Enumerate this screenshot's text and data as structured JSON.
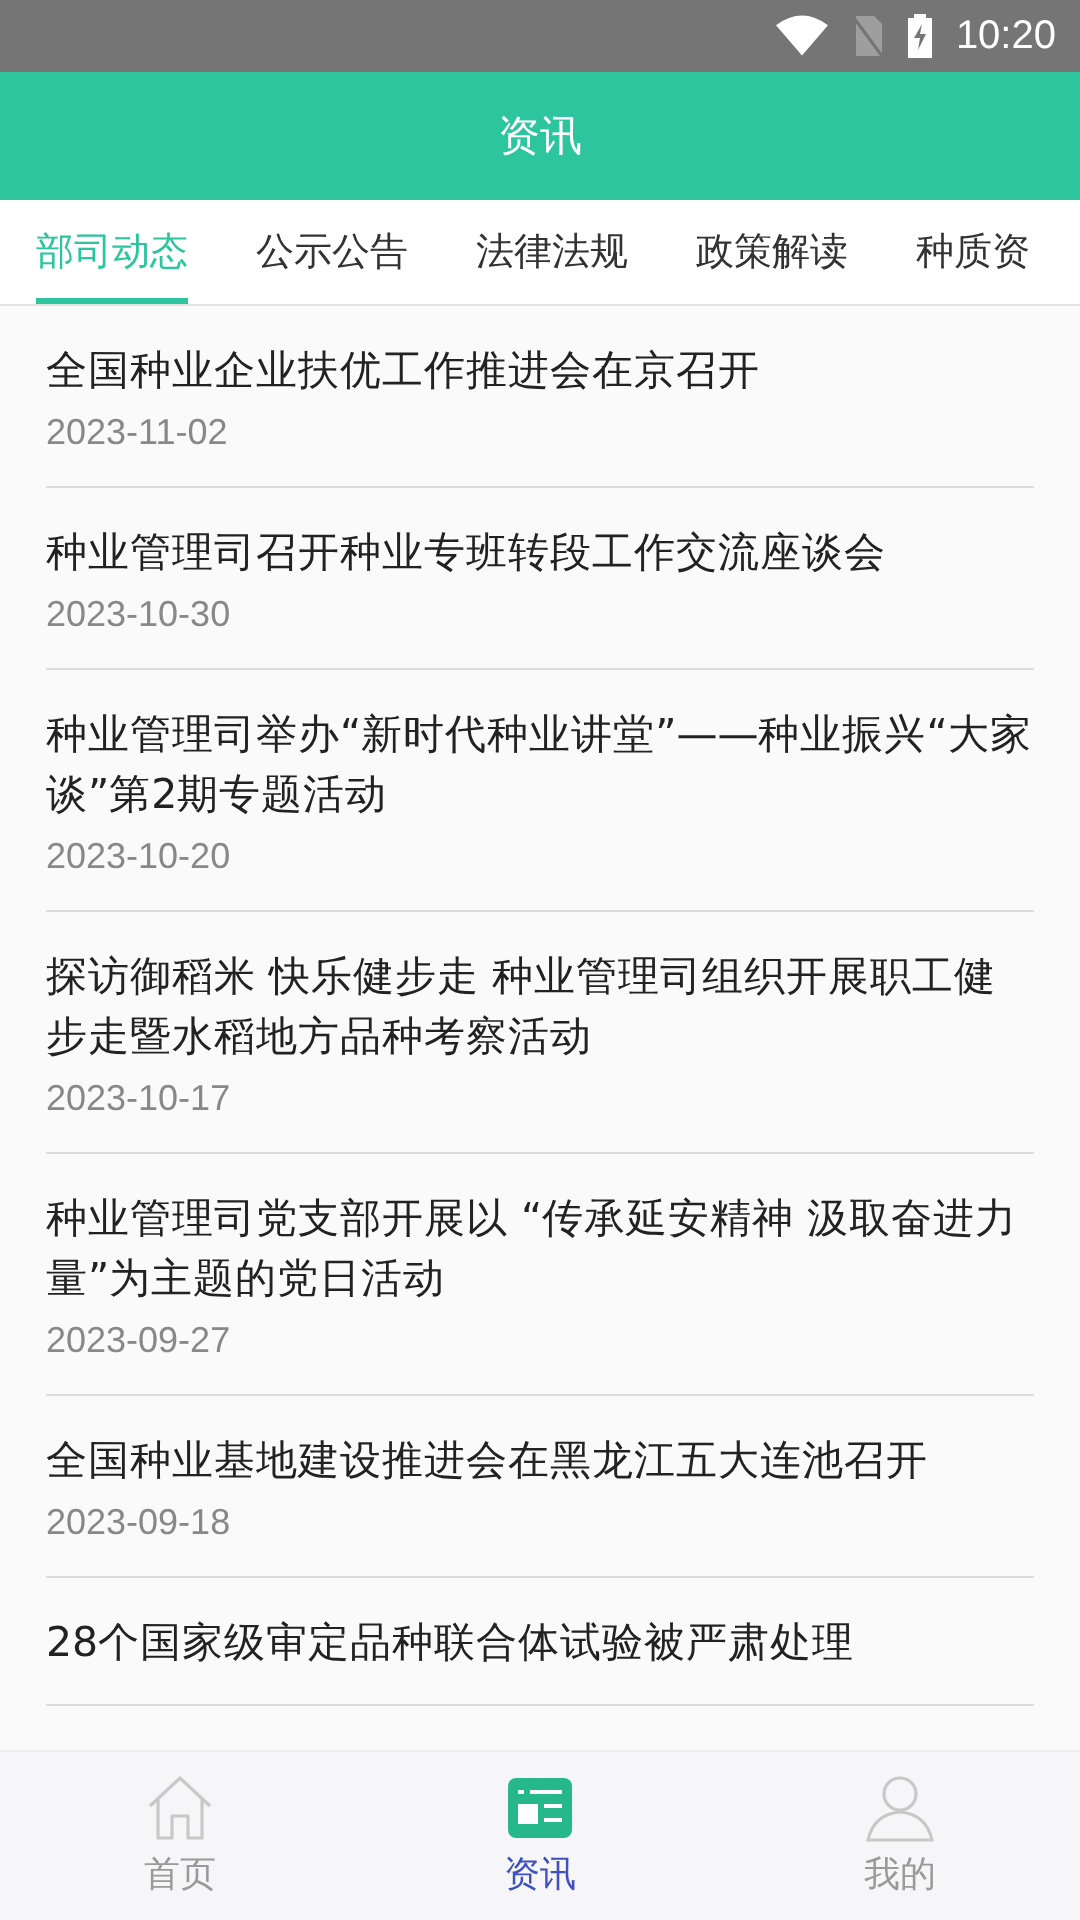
{
  "status_bar": {
    "time": "10:20"
  },
  "header": {
    "title": "资讯"
  },
  "tabs": [
    {
      "label": "部司动态",
      "selected": true
    },
    {
      "label": "公示公告",
      "selected": false
    },
    {
      "label": "法律法规",
      "selected": false
    },
    {
      "label": "政策解读",
      "selected": false
    },
    {
      "label": "种质资",
      "selected": false
    }
  ],
  "articles": [
    {
      "title": "全国种业企业扶优工作推进会在京召开",
      "date": "2023-11-02"
    },
    {
      "title": "种业管理司召开种业专班转段工作交流座谈会",
      "date": "2023-10-30"
    },
    {
      "title": "种业管理司举办“新时代种业讲堂”——种业振兴“大家谈”第2期专题活动",
      "date": "2023-10-20"
    },
    {
      "title": "探访御稻米 快乐健步走 种业管理司组织开展职工健步走暨水稻地方品种考察活动",
      "date": "2023-10-17"
    },
    {
      "title": "种业管理司党支部开展以 “传承延安精神 汲取奋进力量”为主题的党日活动",
      "date": "2023-09-27"
    },
    {
      "title": "全国种业基地建设推进会在黑龙江五大连池召开",
      "date": "2023-09-18"
    },
    {
      "title": "28个国家级审定品种联合体试验被严肃处理"
    }
  ],
  "bottom_nav": [
    {
      "label": "首页",
      "kind": "home",
      "selected": false
    },
    {
      "label": "资讯",
      "kind": "news",
      "selected": true
    },
    {
      "label": "我的",
      "kind": "profile",
      "selected": false
    }
  ]
}
